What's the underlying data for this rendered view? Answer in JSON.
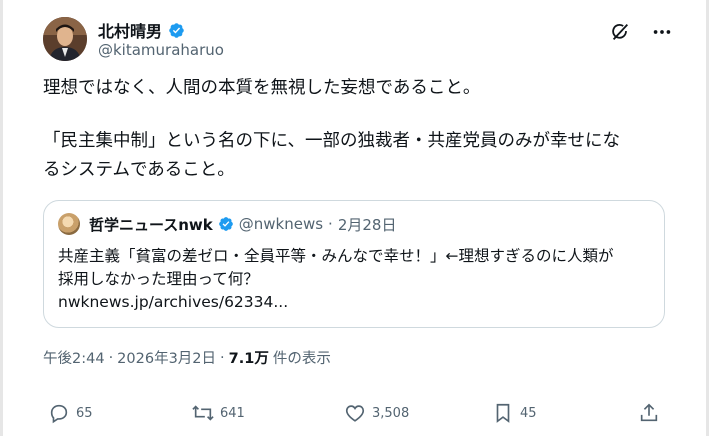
{
  "author": {
    "display_name": "北村晴男",
    "handle": "@kitamuraharuo",
    "verified": true
  },
  "post": {
    "paragraph1": "理想ではなく、人間の本質を無視した妄想であること。",
    "paragraph2_line1": "「民主集中制」という名の下に、一部の独裁者・共産党員のみが幸せにな",
    "paragraph2_line2": "るシステムであること。"
  },
  "quote": {
    "display_name": "哲学ニュースnwk",
    "handle": "@nwknews",
    "separator": "·",
    "date": "2月28日",
    "text_line1": "共産主義「貧富の差ゼロ・全員平等・みんなで幸せ！」←理想すぎるのに人類が",
    "text_line2": "採用しなかった理由って何？",
    "link": "nwknews.jp/archives/62334..."
  },
  "meta": {
    "time": "午後2:44",
    "separator": "·",
    "date": "2026年3月2日",
    "separator2": "·",
    "views_count": "7.1万",
    "views_label": "件の表示"
  },
  "actions": {
    "replies": "65",
    "reposts": "641",
    "likes": "3,508",
    "bookmarks": "45"
  },
  "colors": {
    "verified": "#1d9bf0",
    "secondary_text": "#536471",
    "primary_text": "#0f1419",
    "border": "#cfd9de"
  },
  "icons": [
    "grok-icon",
    "more-icon",
    "reply-icon",
    "repost-icon",
    "like-icon",
    "bookmark-icon",
    "share-icon",
    "verified-icon"
  ]
}
